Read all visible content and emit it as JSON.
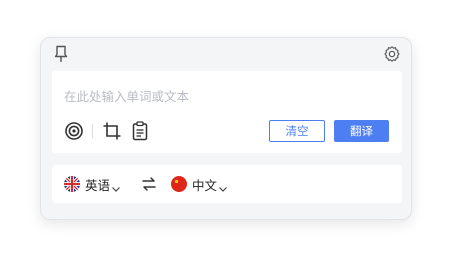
{
  "icons": {
    "pin": "pin-icon",
    "settings": "gear-icon",
    "ocr": "target-icon",
    "screenshot": "crop-icon",
    "clipboard": "clipboard-icon",
    "swap": "swap-icon",
    "chevron": "chevron-down-icon"
  },
  "input": {
    "placeholder": "在此处输入单词或文本",
    "value": ""
  },
  "buttons": {
    "clear_label": "清空",
    "translate_label": "翻译"
  },
  "languages": {
    "source": {
      "label": "英语",
      "flag": "uk-flag"
    },
    "target": {
      "label": "中文",
      "flag": "china-flag"
    }
  },
  "colors": {
    "accent": "#4d7ef2",
    "panel_bg": "#f4f5f7",
    "card_bg": "#ffffff"
  }
}
